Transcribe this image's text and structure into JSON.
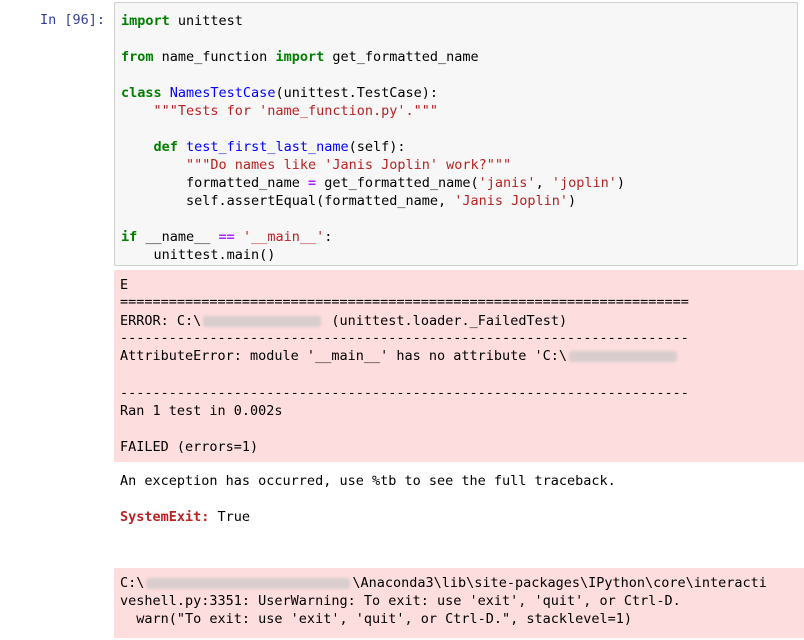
{
  "cell": {
    "prompt": "In [96]:",
    "code": {
      "l1_kw": "import",
      "l1_rest": " unittest",
      "l3_kw1": "from",
      "l3_mid": " name_function ",
      "l3_kw2": "import",
      "l3_rest": " get_formatted_name",
      "l5_kw": "class",
      "l5_name": "NamesTestCase",
      "l5_rest": "(unittest.TestCase):",
      "l6_str": "\"\"\"Tests for 'name_function.py'.\"\"\"",
      "l8_kw": "def",
      "l8_name": "test_first_last_name",
      "l8_rest": "(self):",
      "l9_str": "\"\"\"Do names like 'Janis Joplin' work?\"\"\"",
      "l10_a": "formatted_name ",
      "l10_op": "=",
      "l10_b": " get_formatted_name(",
      "l10_s1": "'janis'",
      "l10_c": ", ",
      "l10_s2": "'joplin'",
      "l10_d": ")",
      "l11_a": "self.assertEqual(formatted_name, ",
      "l11_s": "'Janis Joplin'",
      "l11_b": ")",
      "l13_kw": "if",
      "l13_a": " __name__ ",
      "l13_op": "==",
      "l13_b": " ",
      "l13_s": "'__main__'",
      "l13_c": ":",
      "l14": "unittest.main()"
    }
  },
  "stderr": {
    "l1": "E",
    "l2": "======================================================================",
    "l3a": "ERROR: C:\\",
    "l3b": " (unittest.loader._FailedTest)",
    "l4": "----------------------------------------------------------------------",
    "l5a": "AttributeError: module '__main__' has no attribute 'C:\\",
    "l7": "----------------------------------------------------------------------",
    "l8": "Ran 1 test in 0.002s",
    "l10": "FAILED (errors=1)"
  },
  "stdout": {
    "l1": "An exception has occurred, use %tb to see the full traceback.",
    "l3a": "SystemExit:",
    "l3b": " True"
  },
  "warning": {
    "l1a": "C:\\",
    "l1b": "\\Anaconda3\\lib\\site-packages\\IPython\\core\\interacti",
    "l2": "veshell.py:3351: UserWarning: To exit: use 'exit', 'quit', or Ctrl-D.",
    "l3": "  warn(\"To exit: use 'exit', 'quit', or Ctrl-D.\", stacklevel=1)"
  }
}
